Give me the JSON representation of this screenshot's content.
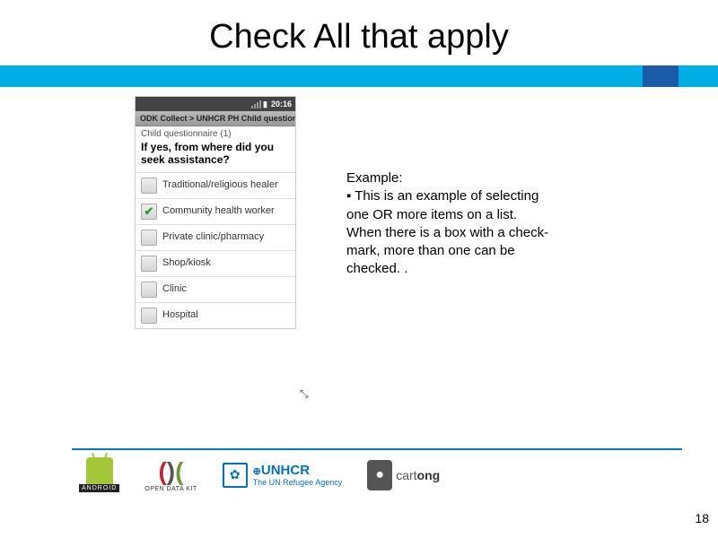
{
  "slide": {
    "title": "Check All that apply",
    "page_number": "18"
  },
  "phone": {
    "statusbar": {
      "time": "20:16"
    },
    "breadcrumb": "ODK Collect > UNHCR PH Child questionnai...",
    "subtitle": "Child questionnaire (1)",
    "question": "If yes, from where did you seek assistance?",
    "options": [
      {
        "label": "Traditional/religious healer",
        "checked": false
      },
      {
        "label": "Community health worker",
        "checked": true
      },
      {
        "label": "Private clinic/pharmacy",
        "checked": false
      },
      {
        "label": "Shop/kiosk",
        "checked": false
      },
      {
        "label": "Clinic",
        "checked": false
      },
      {
        "label": "Hospital",
        "checked": false
      }
    ]
  },
  "example": {
    "heading": "Example:",
    "bullet": "▪ This is an example of selecting one OR more items on a list.",
    "line2": "When there is a box with a check-mark, more than one can be checked. ."
  },
  "logos": {
    "android": "ANDROID",
    "odk": "OPEN DATA KIT",
    "unhcr_l1": "UNHCR",
    "unhcr_l2": "The UN Refugee Agency",
    "cartong": "cartong"
  }
}
